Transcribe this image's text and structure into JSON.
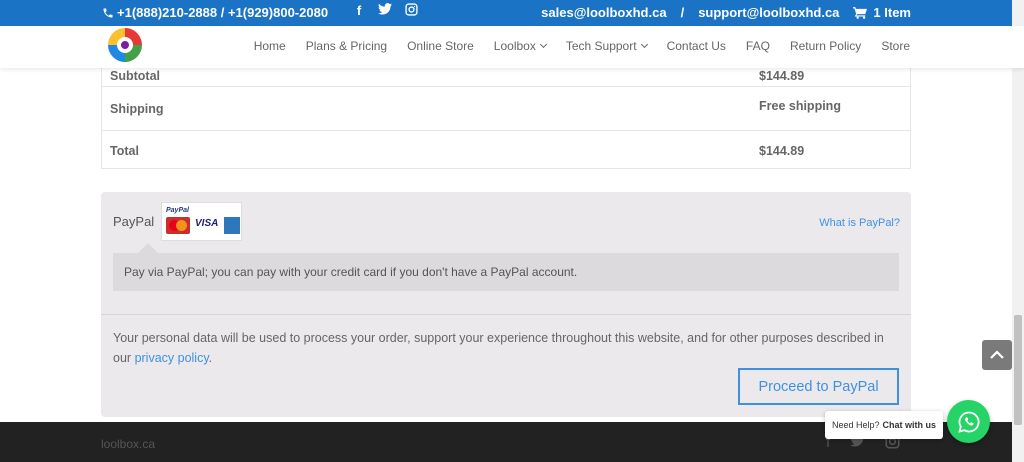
{
  "topbar": {
    "phone": "+1(888)210-2888 / +1(929)800-2080",
    "social_icons": [
      "facebook-icon",
      "twitter-icon",
      "instagram-icon"
    ],
    "email_sales": "sales@loolboxhd.ca",
    "separator": "/",
    "email_support": "support@loolboxhd.ca",
    "cart_label": "1 Item"
  },
  "nav": {
    "items": [
      {
        "label": "Home"
      },
      {
        "label": "Plans & Pricing"
      },
      {
        "label": "Online Store"
      },
      {
        "label": "Loolbox",
        "dropdown": true
      },
      {
        "label": "Tech Support",
        "dropdown": true
      },
      {
        "label": "Contact Us"
      },
      {
        "label": "FAQ"
      },
      {
        "label": "Return Policy"
      },
      {
        "label": "Store"
      }
    ]
  },
  "totals": {
    "subtotal_label": "Subtotal",
    "subtotal_value": "$144.89",
    "shipping_label": "Shipping",
    "shipping_value": "Free shipping",
    "total_label": "Total",
    "total_value": "$144.89"
  },
  "payment": {
    "method_label": "PayPal",
    "logo_word": "PayPal",
    "visa_word": "VISA",
    "what_is": "What is PayPal?",
    "description": "Pay via PayPal; you can pay with your credit card if you don't have a PayPal account.",
    "privacy_text": "Your personal data will be used to process your order, support your experience throughout this website, and for other purposes described in our",
    "privacy_link": "privacy policy",
    "privacy_end": ".",
    "proceed_label": "Proceed to PayPal"
  },
  "footer": {
    "brand": "loolbox.ca"
  },
  "chat": {
    "prefix": "Need Help?",
    "bold": "Chat with us"
  },
  "colors": {
    "topbar": "#1a73c5",
    "accent": "#3f91e0",
    "whatsapp": "#25d366"
  }
}
